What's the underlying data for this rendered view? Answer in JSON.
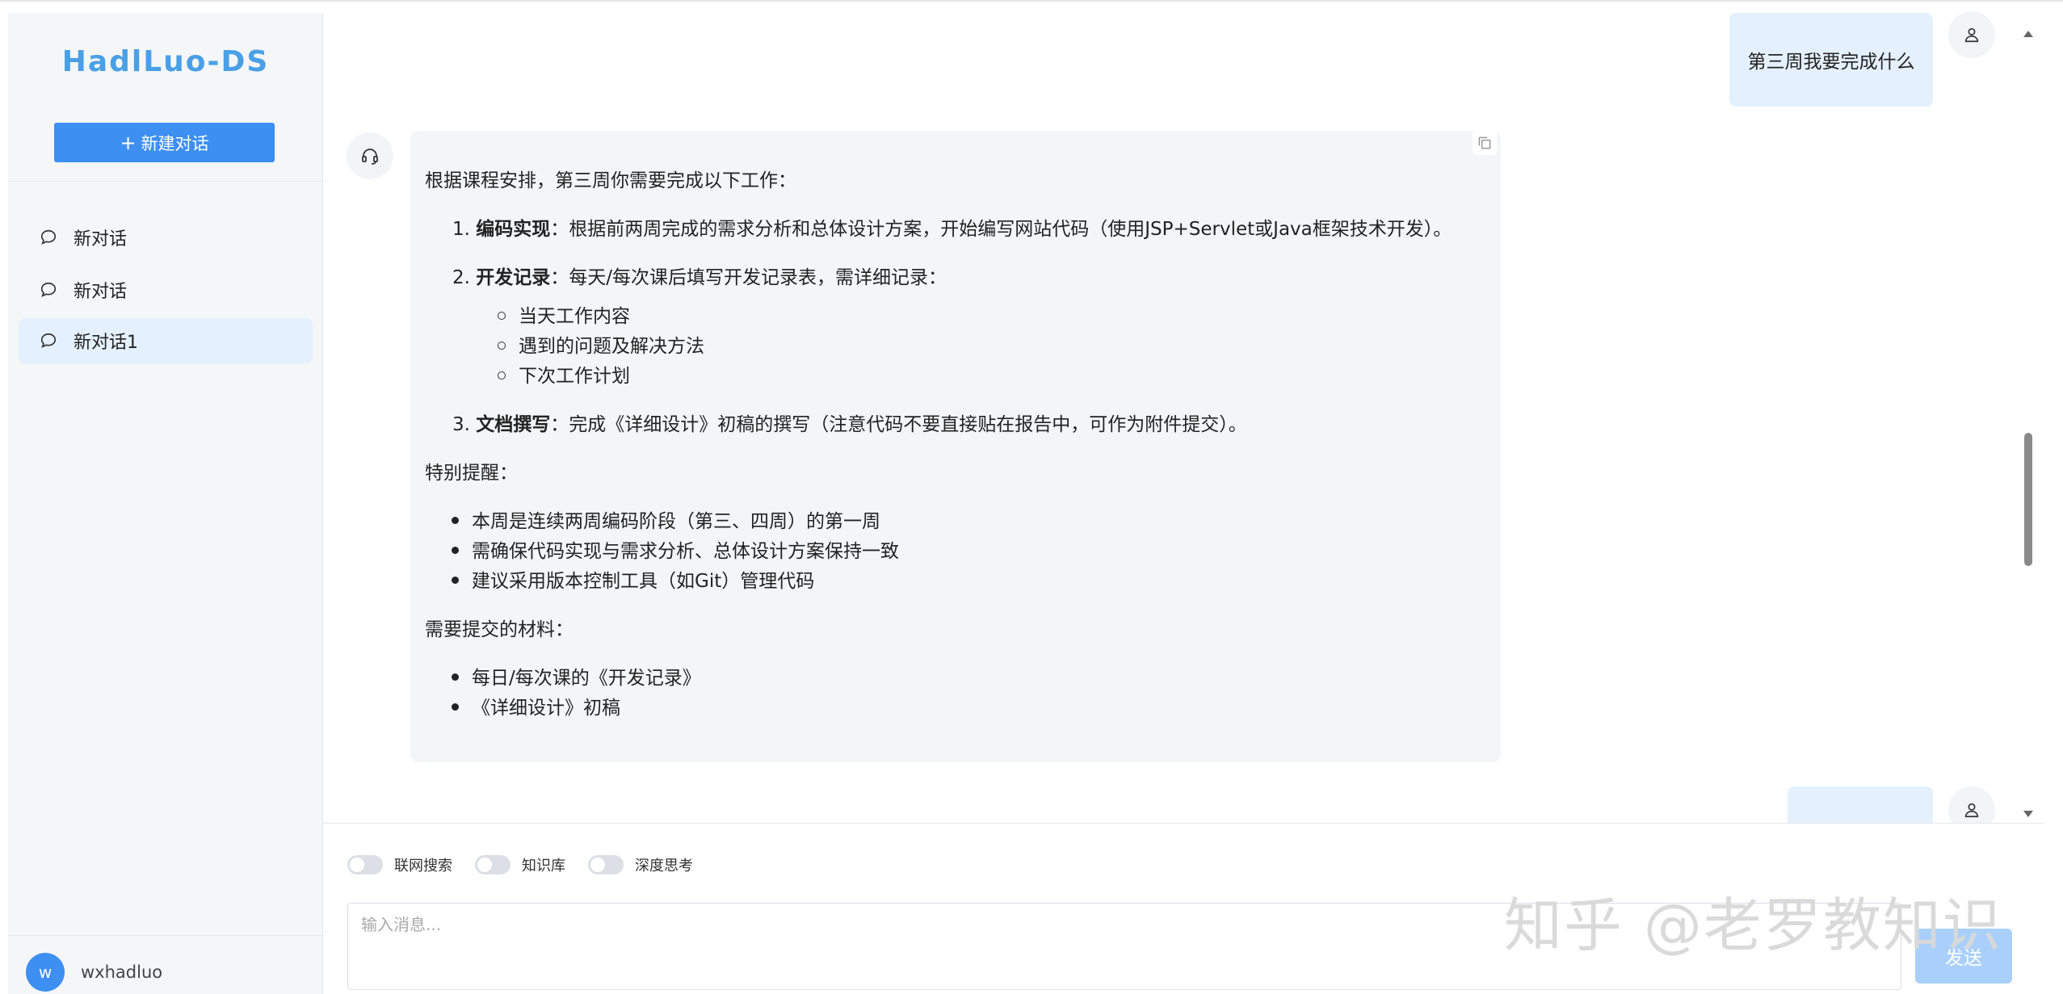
{
  "sidebar": {
    "logo": "HadlLuo-DS",
    "new_chat_label": "新建对话",
    "items": [
      {
        "label": "新对话"
      },
      {
        "label": "新对话"
      },
      {
        "label": "新对话1"
      }
    ],
    "user": {
      "avatar_letter": "w",
      "name": "wxhadluo"
    }
  },
  "chat": {
    "user_message_1": "第三周我要完成什么",
    "assistant": {
      "intro": "根据课程安排，第三周你需要完成以下工作：",
      "steps": [
        {
          "num": "1.",
          "title": "编码实现",
          "text": "：根据前两周完成的需求分析和总体设计方案，开始编写网站代码（使用JSP+Servlet或Java框架技术开发）。"
        },
        {
          "num": "2.",
          "title": "开发记录",
          "text": "：每天/每次课后填写开发记录表，需详细记录："
        },
        {
          "num": "3.",
          "title": "文档撰写",
          "text": "：完成《详细设计》初稿的撰写（注意代码不要直接贴在报告中，可作为附件提交）。"
        }
      ],
      "step2_sub": [
        "当天工作内容",
        "遇到的问题及解决方法",
        "下次工作计划"
      ],
      "reminder_title": "特别提醒：",
      "reminders": [
        "本周是连续两周编码阶段（第三、四周）的第一周",
        "需确保代码实现与需求分析、总体设计方案保持一致",
        "建议采用版本控制工具（如Git）管理代码"
      ],
      "materials_title": "需要提交的材料：",
      "materials": [
        "每日/每次课的《开发记录》",
        "《详细设计》初稿"
      ]
    }
  },
  "input": {
    "toggles": [
      {
        "label": "联网搜索",
        "on": false
      },
      {
        "label": "知识库",
        "on": false
      },
      {
        "label": "深度思考",
        "on": false
      }
    ],
    "placeholder": "输入消息...",
    "send_label": "发送"
  },
  "watermark": "知乎 @老罗教知识",
  "colors": {
    "accent": "#3d8ff2",
    "user_bubble": "#e4f0fd",
    "sidebar_bg": "#f5f6f8",
    "assistant_bg": "#f4f5f7",
    "send_disabled": "#a9d0fb"
  }
}
